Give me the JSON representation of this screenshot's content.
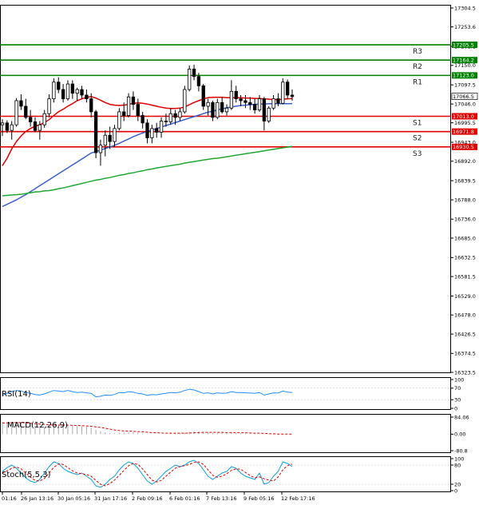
{
  "chart_data": {
    "type": "candlestick",
    "instrument_price_axis": {
      "ticks": [
        "17304.5",
        "17253.6",
        "17201.1",
        "17150.0",
        "17097.5",
        "17046.0",
        "16995.5",
        "16943.0",
        "16892.0",
        "16839.5",
        "16788.0",
        "16736.0",
        "16685.0",
        "16632.5",
        "16581.5",
        "16529.0",
        "16478.0",
        "16426.5",
        "16374.5",
        "16323.5"
      ],
      "range": [
        16323.5,
        17304.5
      ]
    },
    "x_labels": [
      "01:16",
      "26 Jan 13:16",
      "30 Jan 05:16",
      "31 Jan 17:16",
      "2 Feb 09:16",
      "6 Feb 01:16",
      "7 Feb 13:16",
      "9 Feb 05:16",
      "12 Feb 17:16"
    ],
    "levels": [
      {
        "name": "R3",
        "value": 17205.5,
        "label": "17205.5",
        "color": "#008000"
      },
      {
        "name": "R2",
        "value": 17164.2,
        "label": "17164.2",
        "color": "#008000"
      },
      {
        "name": "R1",
        "value": 17123.0,
        "label": "17123.0",
        "color": "#008000"
      },
      {
        "name": "S1",
        "value": 17013.0,
        "label": "17013.0",
        "color": "#e00000"
      },
      {
        "name": "S2",
        "value": 16971.8,
        "label": "16971.8",
        "color": "#e00000"
      },
      {
        "name": "S3",
        "value": 16930.5,
        "label": "16930.5",
        "color": "#e00000"
      }
    ],
    "current_price": {
      "value": 17066.5,
      "label": "17066.5"
    },
    "candles": [
      [
        16990,
        17005,
        16960,
        16995
      ],
      [
        16995,
        17002,
        16968,
        16975
      ],
      [
        16975,
        17000,
        16950,
        16990
      ],
      [
        16990,
        17062,
        16985,
        17055
      ],
      [
        17055,
        17072,
        17030,
        17040
      ],
      [
        17040,
        17060,
        17005,
        17010
      ],
      [
        17010,
        17030,
        16985,
        16998
      ],
      [
        16998,
        17010,
        16970,
        16975
      ],
      [
        16975,
        17000,
        16950,
        16990
      ],
      [
        16990,
        17030,
        16982,
        17020
      ],
      [
        17020,
        17072,
        17010,
        17060
      ],
      [
        17060,
        17115,
        17050,
        17105
      ],
      [
        17105,
        17118,
        17075,
        17085
      ],
      [
        17085,
        17100,
        17050,
        17060
      ],
      [
        17060,
        17110,
        17055,
        17100
      ],
      [
        17100,
        17110,
        17060,
        17075
      ],
      [
        17075,
        17090,
        17055,
        17085
      ],
      [
        17085,
        17095,
        17060,
        17070
      ],
      [
        17070,
        17085,
        17050,
        17060
      ],
      [
        17060,
        17075,
        17010,
        17025
      ],
      [
        17025,
        17030,
        16900,
        16915
      ],
      [
        16915,
        16950,
        16880,
        16935
      ],
      [
        16935,
        16975,
        16905,
        16962
      ],
      [
        16962,
        16985,
        16925,
        16945
      ],
      [
        16945,
        16990,
        16930,
        16980
      ],
      [
        16980,
        17035,
        16975,
        17025
      ],
      [
        17025,
        17050,
        17000,
        17015
      ],
      [
        17015,
        17075,
        17010,
        17065
      ],
      [
        17065,
        17080,
        17030,
        17045
      ],
      [
        17045,
        17060,
        17000,
        17015
      ],
      [
        17015,
        17025,
        16980,
        16995
      ],
      [
        16995,
        17005,
        16940,
        16955
      ],
      [
        16955,
        16990,
        16940,
        16980
      ],
      [
        16980,
        16995,
        16955,
        16970
      ],
      [
        16970,
        17010,
        16955,
        17000
      ],
      [
        17000,
        17020,
        16985,
        16998
      ],
      [
        16998,
        17035,
        16990,
        17020
      ],
      [
        17020,
        17030,
        16990,
        17010
      ],
      [
        17010,
        17035,
        17000,
        17025
      ],
      [
        17025,
        17095,
        17020,
        17085
      ],
      [
        17085,
        17150,
        17080,
        17140
      ],
      [
        17140,
        17152,
        17110,
        17120
      ],
      [
        17120,
        17130,
        17080,
        17095
      ],
      [
        17095,
        17100,
        17030,
        17040
      ],
      [
        17040,
        17060,
        17015,
        17050
      ],
      [
        17050,
        17055,
        17000,
        17010
      ],
      [
        17010,
        17060,
        17005,
        17050
      ],
      [
        17050,
        17065,
        17020,
        17025
      ],
      [
        17025,
        17045,
        17015,
        17035
      ],
      [
        17035,
        17110,
        17030,
        17080
      ],
      [
        17080,
        17095,
        17050,
        17060
      ],
      [
        17060,
        17070,
        17040,
        17055
      ],
      [
        17055,
        17070,
        17035,
        17050
      ],
      [
        17050,
        17065,
        17030,
        17045
      ],
      [
        17045,
        17060,
        17020,
        17030
      ],
      [
        17030,
        17070,
        17025,
        17060
      ],
      [
        17060,
        17065,
        16975,
        17000
      ],
      [
        17000,
        17040,
        16995,
        17035
      ],
      [
        17035,
        17070,
        17030,
        17060
      ],
      [
        17060,
        17075,
        17040,
        17048
      ],
      [
        17048,
        17115,
        17045,
        17105
      ],
      [
        17105,
        17112,
        17060,
        17070
      ],
      [
        17070,
        17085,
        17055,
        17066
      ]
    ],
    "series": [
      {
        "key": "fast_ma",
        "color": "#e00000",
        "values": [
          16880,
          16900,
          16925,
          16945,
          16960,
          16972,
          16980,
          16986,
          16990,
          16996,
          17004,
          17015,
          17025,
          17032,
          17040,
          17047,
          17055,
          17060,
          17064,
          17066,
          17062,
          17056,
          17050,
          17045,
          17043,
          17042,
          17043,
          17045,
          17048,
          17049,
          17048,
          17046,
          17043,
          17040,
          17037,
          17035,
          17034,
          17034,
          17035,
          17038,
          17044,
          17050,
          17055,
          17060,
          17063,
          17064,
          17064,
          17064,
          17063,
          17063,
          17063,
          17063,
          17062,
          17062,
          17061,
          17061,
          17060,
          17059,
          17058,
          17058,
          17059,
          17060,
          17061
        ]
      },
      {
        "key": "slow_ma",
        "color": "#3a5fcd",
        "values": [
          16770,
          16776,
          16782,
          16788,
          16795,
          16802,
          16810,
          16818,
          16826,
          16834,
          16842,
          16850,
          16858,
          16866,
          16874,
          16882,
          16890,
          16898,
          16906,
          16914,
          16918,
          16922,
          16926,
          16930,
          16935,
          16940,
          16946,
          16952,
          16958,
          16963,
          16968,
          16972,
          16976,
          16980,
          16984,
          16988,
          16992,
          16996,
          17000,
          17004,
          17008,
          17012,
          17016,
          17020,
          17024,
          17027,
          17030,
          17033,
          17036,
          17038,
          17040,
          17042,
          17043,
          17044,
          17045,
          17046,
          17046,
          17047,
          17047,
          17047,
          17047,
          17047,
          17047
        ]
      },
      {
        "key": "long_ma",
        "color": "#22a832",
        "values": [
          16799,
          16800,
          16801,
          16802,
          16803,
          16805,
          16807,
          16809,
          16810,
          16812,
          16813,
          16815,
          16818,
          16820,
          16823,
          16826,
          16829,
          16832,
          16835,
          16838,
          16841,
          16843,
          16846,
          16848,
          16851,
          16854,
          16856,
          16859,
          16861,
          16864,
          16866,
          16869,
          16871,
          16874,
          16876,
          16878,
          16880,
          16882,
          16884,
          16887,
          16889,
          16891,
          16893,
          16895,
          16897,
          16899,
          16900,
          16902,
          16904,
          16906,
          16908,
          16910,
          16912,
          16914,
          16916,
          16918,
          16920,
          16922,
          16924,
          16926,
          16928,
          16930,
          16932
        ]
      }
    ],
    "indicators": [
      {
        "name": "RSI(14)",
        "ticks": [
          "100",
          "70",
          "30",
          "0"
        ],
        "range": [
          0,
          100
        ],
        "color": "#1f8fff",
        "values": [
          45,
          52,
          58,
          62,
          60,
          55,
          52,
          48,
          46,
          50,
          56,
          62,
          60,
          58,
          62,
          58,
          55,
          56,
          54,
          52,
          40,
          42,
          46,
          45,
          48,
          55,
          54,
          58,
          56,
          52,
          50,
          45,
          48,
          47,
          50,
          52,
          55,
          54,
          56,
          62,
          66,
          64,
          58,
          52,
          54,
          50,
          54,
          52,
          53,
          58,
          55,
          55,
          54,
          53,
          52,
          55,
          46,
          50,
          54,
          53,
          60,
          56,
          55
        ]
      },
      {
        "name": "MACD(12,26,9)",
        "ticks": [
          "84.06",
          "0.00",
          "-80.8"
        ],
        "range": [
          -80.8,
          84.06
        ],
        "hist_color": "#aaaaaa",
        "signal_color": "#e00000",
        "hist": [
          60,
          58,
          57,
          58,
          55,
          50,
          46,
          42,
          38,
          36,
          38,
          42,
          45,
          44,
          44,
          42,
          40,
          38,
          36,
          33,
          22,
          15,
          10,
          6,
          4,
          6,
          8,
          10,
          10,
          8,
          5,
          2,
          0,
          -1,
          0,
          1,
          3,
          4,
          5,
          8,
          12,
          14,
          14,
          12,
          10,
          8,
          7,
          6,
          6,
          7,
          6,
          5,
          4,
          3,
          2,
          2,
          -2,
          -3,
          -2,
          -2,
          0,
          0,
          0
        ],
        "signal": [
          55,
          56,
          57,
          57,
          57,
          56,
          54,
          52,
          50,
          48,
          46,
          45,
          45,
          45,
          45,
          44,
          43,
          42,
          41,
          39,
          36,
          33,
          29,
          25,
          21,
          18,
          16,
          15,
          14,
          13,
          12,
          10,
          8,
          7,
          6,
          5,
          5,
          5,
          5,
          5,
          6,
          7,
          8,
          9,
          9,
          9,
          9,
          9,
          8,
          8,
          8,
          7,
          7,
          6,
          5,
          5,
          4,
          3,
          2,
          1,
          1,
          1,
          1
        ]
      },
      {
        "name": "Stoch(5,5,3)",
        "ticks": [
          "100",
          "80",
          "20",
          "0"
        ],
        "range": [
          0,
          100
        ],
        "main_color": "#0aa0d8",
        "signal_color": "#e00000",
        "main": [
          60,
          72,
          80,
          70,
          55,
          40,
          30,
          25,
          35,
          55,
          75,
          90,
          85,
          70,
          60,
          55,
          50,
          55,
          45,
          35,
          15,
          10,
          20,
          35,
          45,
          65,
          80,
          90,
          85,
          70,
          50,
          30,
          20,
          30,
          45,
          60,
          70,
          80,
          75,
          80,
          90,
          95,
          85,
          65,
          45,
          35,
          45,
          55,
          60,
          75,
          70,
          55,
          45,
          40,
          35,
          55,
          20,
          25,
          45,
          60,
          90,
          85,
          75
        ],
        "signal": [
          55,
          62,
          70,
          74,
          68,
          55,
          42,
          32,
          30,
          38,
          55,
          73,
          83,
          82,
          72,
          62,
          55,
          53,
          50,
          45,
          32,
          20,
          15,
          22,
          33,
          48,
          63,
          78,
          85,
          82,
          68,
          50,
          33,
          27,
          32,
          45,
          58,
          70,
          75,
          78,
          82,
          88,
          90,
          82,
          65,
          48,
          42,
          45,
          53,
          63,
          68,
          67,
          57,
          47,
          40,
          43,
          37,
          33,
          30,
          43,
          65,
          78,
          83
        ]
      }
    ]
  }
}
